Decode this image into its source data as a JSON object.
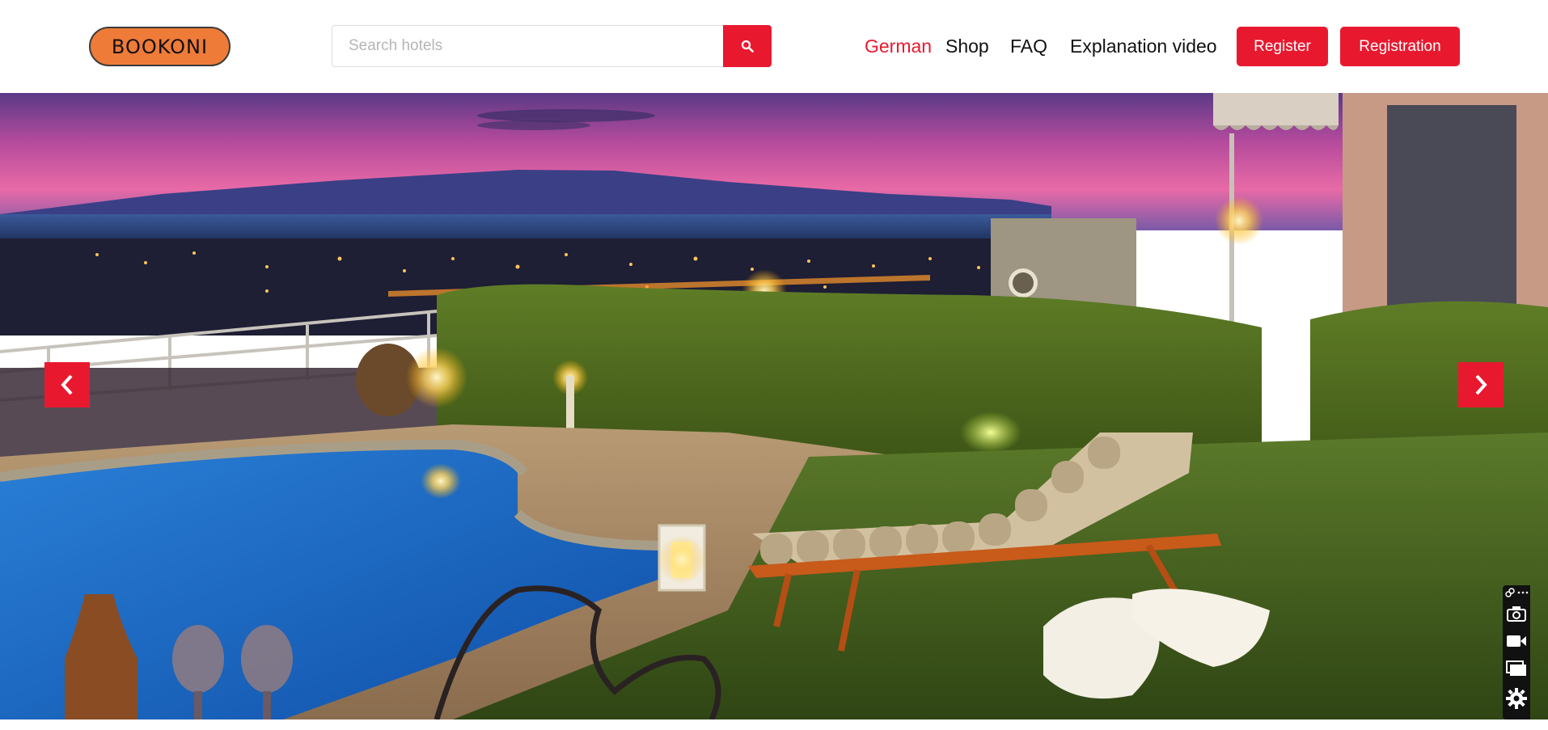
{
  "app": {
    "logo_text": "BOOKONI"
  },
  "search": {
    "placeholder": "Search hotels",
    "value": "",
    "button_icon": "search-icon"
  },
  "nav": {
    "language": "German",
    "shop": "Shop",
    "faq": "FAQ",
    "explanation_video": "Explanation video"
  },
  "auth": {
    "register_label": "Register",
    "registration_label": "Registration"
  },
  "hero": {
    "image": "night-pool-terrace-with-sun-lounger",
    "prev_icon": "chevron-left-icon",
    "next_icon": "chevron-right-icon"
  },
  "toolbar": {
    "icons": [
      "link-icon",
      "more-icon",
      "camera-icon",
      "video-icon",
      "window-icon",
      "settings-icon"
    ]
  },
  "colors": {
    "accent": "#e8192f",
    "logo_bg": "#ef7b38",
    "text": "#111111"
  }
}
